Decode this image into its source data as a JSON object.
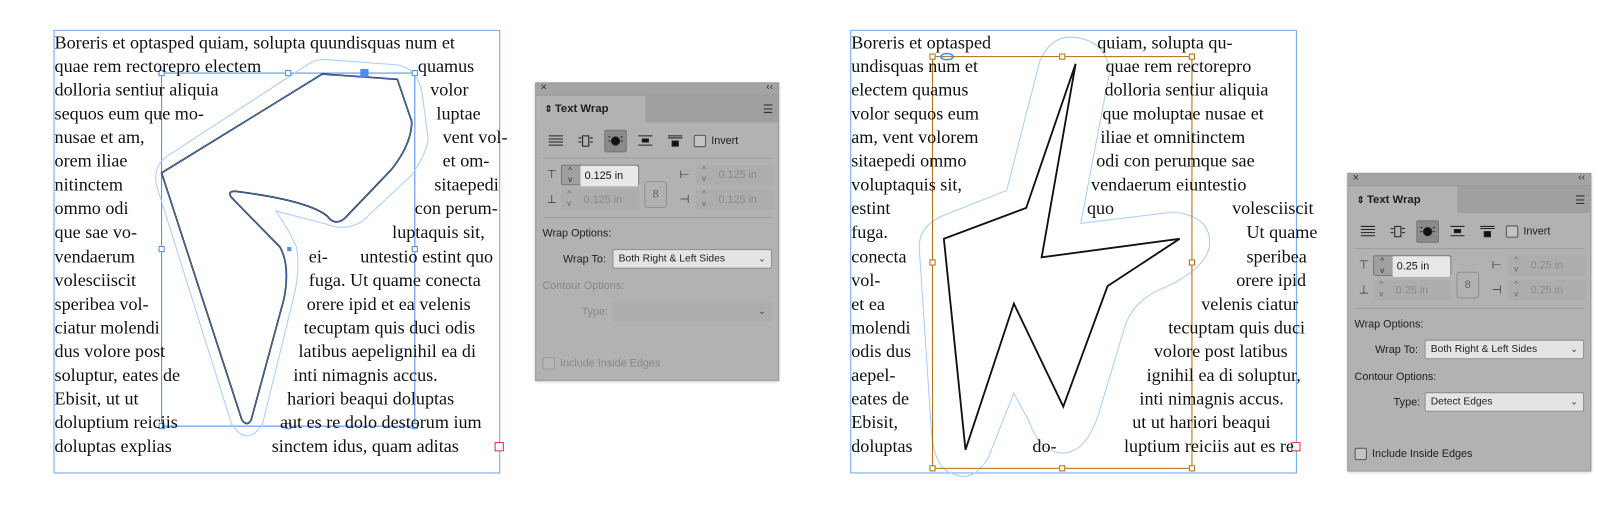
{
  "documents": [
    {
      "lines": [
        [
          "Boreris et optasped quiam, solupta quundisquas num et"
        ],
        [
          "quae rem rectorepro electem",
          "quamus"
        ],
        [
          "dolloria sentiur aliquia",
          "volor"
        ],
        [
          "sequos eum que mo-",
          "luptae"
        ],
        [
          "nusae et am,",
          "vent vol-"
        ],
        [
          "orem iliae",
          "et om-"
        ],
        [
          "nitinctem",
          "sitaepedi"
        ],
        [
          "ommo odi",
          "con perum-"
        ],
        [
          "que sae vo-",
          "luptaquis sit,"
        ],
        [
          "vendaerum",
          "ei-",
          "untestio estint quo"
        ],
        [
          "volesciiscit",
          "fuga. Ut quame conecta"
        ],
        [
          "speribea vol-",
          "orere ipid et ea velenis"
        ],
        [
          "ciatur molendi",
          "tecuptam quis duci odis"
        ],
        [
          "dus volore post",
          "latibus aepelignihil ea di"
        ],
        [
          "soluptur, eates de",
          "inti nimagnis accus."
        ],
        [
          "Ebisit, ut ut",
          "hariori beaqui doluptas"
        ],
        [
          "doluptium reiciis",
          "aut es re dolo destorum ium"
        ],
        [
          "doluptas explias",
          "sinctem idus, quam aditas"
        ]
      ]
    },
    {
      "lines": [
        [
          "Boreris et optasped",
          "quiam, solupta qu-"
        ],
        [
          "undisquas num et",
          "quae rem rectorepro"
        ],
        [
          "electem quamus",
          "dolloria sentiur aliquia"
        ],
        [
          "volor sequos eum",
          "que moluptae nusae et"
        ],
        [
          "am, vent volorem",
          "iliae et omnitinctem"
        ],
        [
          "sitaepedi ommo",
          "odi con perumque sae"
        ],
        [
          "voluptaquis sit,",
          "vendaerum eiuntestio"
        ],
        [
          "estint",
          "quo",
          "volesciiscit"
        ],
        [
          "fuga.",
          "Ut quame"
        ],
        [
          "conecta",
          "speribea"
        ],
        [
          "vol-",
          "orere ipid"
        ],
        [
          "et ea",
          "velenis ciatur"
        ],
        [
          "molendi",
          "tecuptam quis duci"
        ],
        [
          "odis dus",
          "volore post latibus"
        ],
        [
          "aepel-",
          "ignihil ea di soluptur,"
        ],
        [
          "eates de",
          "inti nimagnis accus."
        ],
        [
          "Ebisit,",
          "ut ut hariori beaqui"
        ],
        [
          "doluptas",
          "do-",
          "luptium reiciis aut es re"
        ]
      ]
    }
  ],
  "panels": [
    {
      "title": "Text Wrap",
      "invert_label": "Invert",
      "invert_checked": false,
      "top_offset": "0.125 in",
      "bottom_offset": "0.125 in",
      "left_offset": "0.125 in",
      "right_offset": "0.125 in",
      "wrap_options_label": "Wrap Options:",
      "wrap_to_label": "Wrap To:",
      "wrap_to_value": "Both Right & Left Sides",
      "contour_options_label": "Contour Options:",
      "type_label": "Type:",
      "type_value": "",
      "contour_enabled": false,
      "include_inside_edges_label": "Include Inside Edges",
      "include_inside_edges_checked": false,
      "selected_wrap_mode": "wrap-around-object-shape"
    },
    {
      "title": "Text Wrap",
      "invert_label": "Invert",
      "invert_checked": false,
      "top_offset": "0.25 in",
      "bottom_offset": "0.25 in",
      "left_offset": "0.25 in",
      "right_offset": "0.25 in",
      "wrap_options_label": "Wrap Options:",
      "wrap_to_label": "Wrap To:",
      "wrap_to_value": "Both Right & Left Sides",
      "contour_options_label": "Contour Options:",
      "type_label": "Type:",
      "type_value": "Detect Edges",
      "contour_enabled": true,
      "include_inside_edges_label": "Include Inside Edges",
      "include_inside_edges_checked": false,
      "selected_wrap_mode": "wrap-around-object-shape"
    }
  ],
  "colors": {
    "text_frame": "#6ea5f0",
    "wrap_contour": "#a9ccff",
    "graphic_frame_left": "#4a8ef0",
    "graphic_frame_right": "#b06f10",
    "panel_bg": "#b2b2b2",
    "overset_marker": "#e03030"
  }
}
